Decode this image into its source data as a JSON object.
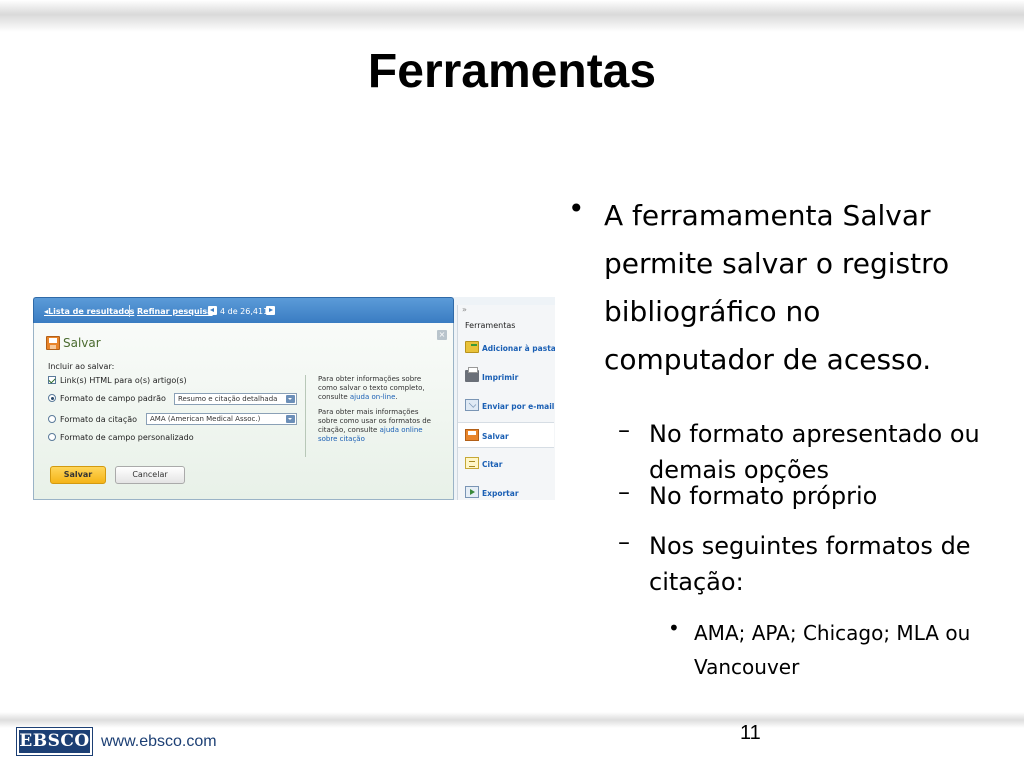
{
  "slide": {
    "title": "Ferramentas",
    "page_number": "11"
  },
  "screenshot": {
    "nav": {
      "results_list": "Lista de resultados",
      "refine_search": "Refinar pesquisa",
      "record_position": "4 de 26,411"
    },
    "dialog": {
      "title": "Salvar",
      "include_label": "Incluir ao salvar:",
      "options": [
        {
          "label": "Link(s) HTML para o(s) artigo(s)",
          "checked": true
        },
        {
          "label": "Formato de campo padrão",
          "selected": true,
          "select_value": "Resumo e citação detalhada"
        },
        {
          "label": "Formato da citação",
          "selected": false,
          "select_value": "AMA (American Medical Assoc.)"
        },
        {
          "label": "Formato de campo personalizado",
          "selected": false
        }
      ],
      "info_1": {
        "text": "Para obter informações sobre como salvar o texto completo, consulte ",
        "link": "ajuda on-line",
        "end": "."
      },
      "info_2": {
        "text": "Para obter mais informações sobre como usar os formatos de citação, consulte ",
        "link": "ajuda online sobre citação"
      },
      "save_button": "Salvar",
      "cancel_button": "Cancelar"
    },
    "tools": {
      "collapse": "»",
      "heading": "Ferramentas",
      "items": [
        {
          "label": "Adicionar à pasta",
          "icon": "folder-icon"
        },
        {
          "label": "Imprimir",
          "icon": "printer-icon"
        },
        {
          "label": "Enviar por e-mail",
          "icon": "email-icon"
        },
        {
          "label": "Salvar",
          "icon": "save-icon",
          "active": true
        },
        {
          "label": "Citar",
          "icon": "cite-icon"
        },
        {
          "label": "Exportar",
          "icon": "export-icon"
        }
      ]
    }
  },
  "bullets": {
    "main": "A ferramamenta Salvar permite salvar o registro bibliográfico no computador de acesso.",
    "sub": [
      "No formato apresentado ou demais opções",
      "No formato próprio",
      "Nos seguintes formatos de citação:"
    ],
    "subsub": [
      "AMA; APA; Chicago; MLA ou Vancouver"
    ]
  },
  "footer": {
    "logo_text": "EBSCO",
    "url": "www.ebsco.com"
  }
}
